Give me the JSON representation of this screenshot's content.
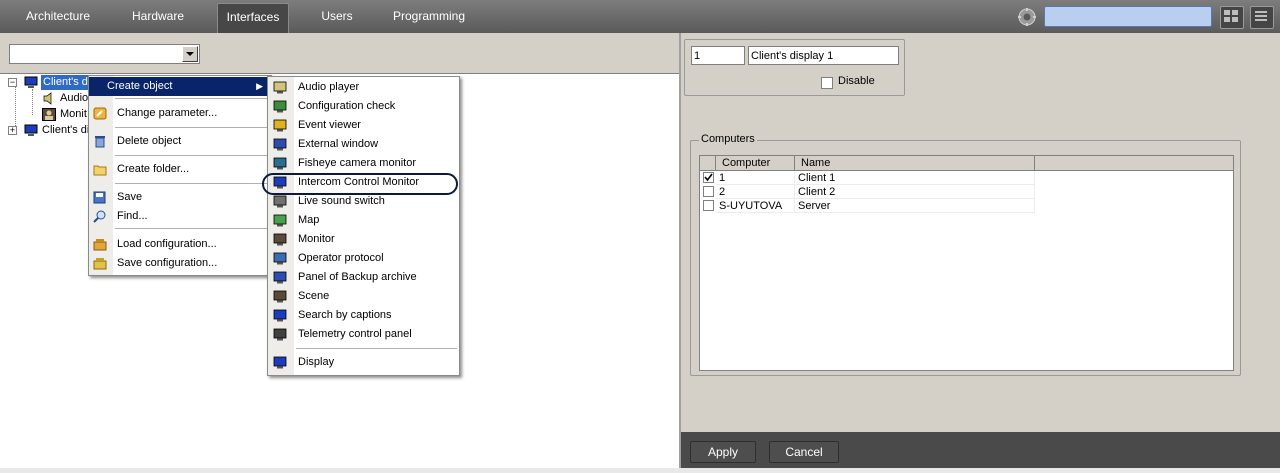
{
  "top_nav": {
    "tabs": [
      {
        "label": "Architecture"
      },
      {
        "label": "Hardware"
      },
      {
        "label": "Interfaces"
      },
      {
        "label": "Users"
      },
      {
        "label": "Programming"
      }
    ],
    "active_tab": "Interfaces",
    "search_value": "",
    "icons": [
      "gear-icon",
      "layout-icon",
      "menu-icon"
    ]
  },
  "left_panel": {
    "combo_value": "",
    "tree": [
      {
        "label": "Client's display 1",
        "visible_text": "Client's di",
        "expanded": true,
        "icon": "monitor-icon"
      },
      {
        "label": "Audio player",
        "visible_text": "Audio",
        "icon": "speaker-icon"
      },
      {
        "label": "Monitor",
        "visible_text": "Monit",
        "icon": "camera-icon"
      },
      {
        "label": "Client's display 2",
        "visible_text": "Client's di",
        "expanded": false,
        "icon": "monitor-icon"
      }
    ]
  },
  "context_menu": {
    "items": [
      {
        "label": "Create object",
        "icon": "",
        "has_submenu": true
      },
      {
        "label": "Change parameter...",
        "icon": "wrench-icon"
      },
      {
        "label": "Delete object",
        "icon": "trash-icon"
      },
      {
        "label": "Create folder...",
        "icon": "folder-icon"
      },
      {
        "label": "Save",
        "icon": "save-icon"
      },
      {
        "label": "Find...",
        "icon": "find-icon"
      },
      {
        "label": "Load configuration...",
        "icon": "load-icon"
      },
      {
        "label": "Save configuration...",
        "icon": "save-config-icon"
      }
    ]
  },
  "submenu": {
    "items": [
      {
        "label": "Audio player",
        "icon": "speaker-icon"
      },
      {
        "label": "Configuration check",
        "icon": "check-icon"
      },
      {
        "label": "Event viewer",
        "icon": "event-icon"
      },
      {
        "label": "External window",
        "icon": "window-icon"
      },
      {
        "label": "Fisheye camera monitor",
        "icon": "fisheye-icon"
      },
      {
        "label": "Intercom Control Monitor",
        "icon": "intercom-icon",
        "circled": true
      },
      {
        "label": "Live sound switch",
        "icon": "sound-switch-icon"
      },
      {
        "label": "Map",
        "icon": "map-icon"
      },
      {
        "label": "Monitor",
        "icon": "camera-icon"
      },
      {
        "label": "Operator protocol",
        "icon": "protocol-icon"
      },
      {
        "label": "Panel of Backup archive",
        "icon": "backup-icon"
      },
      {
        "label": "Scene",
        "icon": "scene-icon"
      },
      {
        "label": "Search by captions",
        "icon": "search-captions-icon"
      },
      {
        "label": "Telemetry control panel",
        "icon": "telemetry-icon"
      },
      {
        "label": "Display",
        "icon": "display-icon"
      }
    ]
  },
  "properties": {
    "id_value": "1",
    "name_value": "Client's display 1",
    "disable_label": "Disable",
    "disable_checked": false,
    "computers_group_label": "Computers",
    "grid_headers": {
      "computer": "Computer",
      "name": "Name"
    },
    "rows": [
      {
        "computer": "1",
        "name": "Client 1",
        "checked": true
      },
      {
        "computer": "2",
        "name": "Client 2",
        "checked": false
      },
      {
        "computer": "S-UYUTOVA",
        "name": "Server",
        "checked": false
      }
    ]
  },
  "buttons": {
    "apply": "Apply",
    "cancel": "Cancel"
  },
  "colors": {
    "topbar": "#6a6a6a",
    "menu_highlight": "#0a246a",
    "search_field": "#b9cff0"
  }
}
